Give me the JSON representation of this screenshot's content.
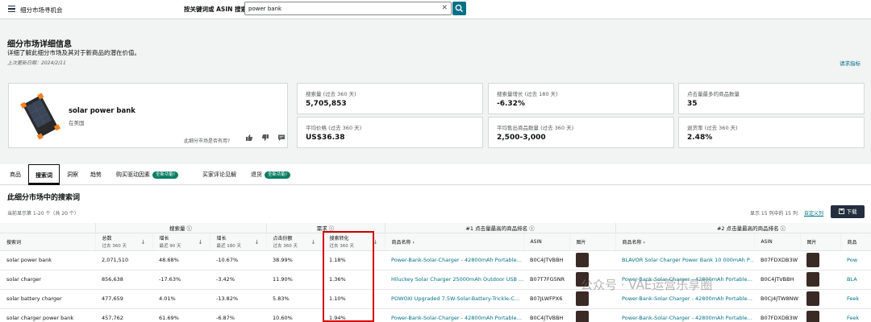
{
  "header": {
    "app_title": "细分市场寻机会",
    "search_label": "按关键词或 ASIN 搜索",
    "search_value": "power bank"
  },
  "page": {
    "title": "细分市场详细信息",
    "subtitle": "详细了解此细分市场及其对于新商品的潜在价值。",
    "last_updated": "上次更新日期：2024/2/11",
    "request_link": "请求指标"
  },
  "product": {
    "name": "solar power bank",
    "status": "在美国",
    "helpful_question": "此细分市场是否有用?"
  },
  "metrics": [
    {
      "label": "搜索量 (过去 360 天)",
      "value": "5,705,853"
    },
    {
      "label": "搜索量增长 (过去 180 天)",
      "value": "-6.32%"
    },
    {
      "label": "点击量最多的商品数量",
      "value": "35"
    },
    {
      "label": "平均价格 (过去 360 天)",
      "value": "US$36.38"
    },
    {
      "label": "平均售出商品数量 (过去 360 天)",
      "value": "2,500-3,000"
    },
    {
      "label": "退货率 (过去 360 天)",
      "value": "2.48%"
    }
  ],
  "tabs": [
    {
      "label": "商品"
    },
    {
      "label": "搜索词"
    },
    {
      "label": "洞察"
    },
    {
      "label": "趋势"
    },
    {
      "label": "购买驱动因素",
      "badge": "全新功能!"
    },
    {
      "label": "买家评论见解"
    },
    {
      "label": "退货",
      "badge": "全新功能!"
    }
  ],
  "section": {
    "title": "此细分市场中的搜索词",
    "showing": "当前显示第 1-20 个（共 20 个）",
    "column_count": "显示 15 列中的 15 列",
    "custom_link": "自定义列",
    "download_label": "下载"
  },
  "table": {
    "groups": [
      "搜索量 ⓘ",
      "需求 ⓘ",
      "#1 点击量最高的商品排名 ⓘ",
      "#2 点击量最高的商品排名 ⓘ"
    ],
    "columns": [
      {
        "l1": "搜索词",
        "l2": ""
      },
      {
        "l1": "总数",
        "l2": "过去 360 天"
      },
      {
        "l1": "增长",
        "l2": "最近 90 天"
      },
      {
        "l1": "增长",
        "l2": "最近 180 天"
      },
      {
        "l1": "点击份额",
        "l2": "过去 360 天"
      },
      {
        "l1": "搜索转化",
        "l2": "过去 360 天"
      },
      {
        "l1": "商品名称 ›",
        "l2": ""
      },
      {
        "l1": "ASIN",
        "l2": ""
      },
      {
        "l1": "图片",
        "l2": ""
      },
      {
        "l1": "商品名称 ›",
        "l2": ""
      },
      {
        "l1": "ASIN",
        "l2": ""
      },
      {
        "l1": "图片",
        "l2": ""
      },
      {
        "l1": "商品",
        "l2": ""
      }
    ],
    "rows": [
      [
        "solar power bank",
        "2,071,510",
        "48.68%",
        "-10.67%",
        "38.99%",
        "1.18%",
        "Power-Bank-Solar-Charger - 42800mAh Portable…",
        "B0C4JTVBBH",
        "",
        "BLAVOR Solar Charger Power Bank 10 000mAh P…",
        "B07FDXDB3W",
        "",
        "Pow"
      ],
      [
        "solar charger",
        "856,638",
        "-17.63%",
        "-3.42%",
        "11.90%",
        "1.36%",
        "Hiluckey Solar Charger 25000mAh Outdoor USB …",
        "B07T7FG5NR",
        "",
        "Power-Bank-Solar-Charger - 42800mAh Portable…",
        "B0C4JTVBBH",
        "",
        "BLA"
      ],
      [
        "solar battery charger",
        "477,659",
        "4.01%",
        "-13.82%",
        "5.83%",
        "1.10%",
        "POWOXI Upgraded 7.5W-Solar-Battery-Trickle-C…",
        "B07JLWFPX6",
        "",
        "Power-Bank-Solar-Charger - 42800mAh Portable…",
        "B0CJ4JTW8NW",
        "",
        "Feek"
      ],
      [
        "solar charger power bank",
        "457,762",
        "61.69%",
        "-6.87%",
        "10.60%",
        "1.94%",
        "Power-Bank-Solar-Charger - 42800mAh Portable…",
        "B0C4JTVBBH",
        "",
        "Power-Bank-Solar-Charger - 42800mAh Portable…",
        "B07FDXDB3W",
        "",
        "Feek"
      ]
    ]
  },
  "watermark": "公众号 · VAE运营乐享圈",
  "colors": {
    "accent": "#007185",
    "header_dark": "#232f3e",
    "badge_green": "#067d62",
    "highlight_red": "#d40000"
  }
}
